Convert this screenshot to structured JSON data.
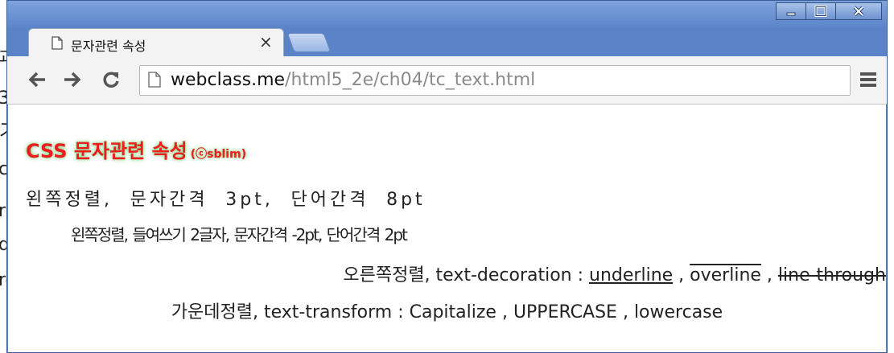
{
  "tab": {
    "title": "문자관련 속성",
    "close": "×"
  },
  "address": {
    "host": "webclass.me",
    "path": "/html5_2e/ch04/tc_text.html"
  },
  "page": {
    "heading": "CSS 문자관련 속성",
    "heading_credit": "(ⓒsblim)",
    "line1": "왼쪽정렬, 문자간격 3pt, 단어간격 8pt",
    "line2": "왼쪽정렬, 들여쓰기 2글자, 문자간격 -2pt, 단어간격 2pt",
    "line3": {
      "prefix": "오른쪽정렬, text-decoration : ",
      "underline": "underline",
      "sep1": " , ",
      "overline": "overline",
      "sep2": " , ",
      "line_through": "line-through"
    },
    "line4": {
      "prefix": "가운데정렬, text-transform : ",
      "capitalize": "Capitalize",
      "sep1": " , ",
      "uppercase": "UPPERCASE",
      "sep2": " , ",
      "lowercase": "lowercase"
    }
  },
  "background_fragments": [
    "괴",
    "3",
    "ス",
    "c",
    "r,",
    "d",
    "rc"
  ],
  "colors": {
    "heading": "#ee1c1c",
    "heading_glow": "#7ccf7c",
    "window_frame": "#5b84c8",
    "url_path": "#8a8a8a"
  },
  "icons": [
    "document-icon",
    "close-icon",
    "minimize-icon",
    "maximize-icon",
    "back-arrow-icon",
    "forward-arrow-icon",
    "reload-icon",
    "menu-icon"
  ]
}
